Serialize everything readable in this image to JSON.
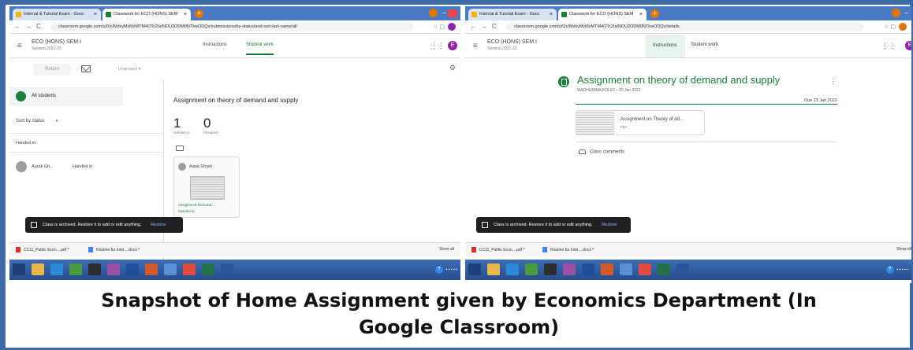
{
  "colors": {
    "frame": "#3f6aa8",
    "classroom_green": "#188038",
    "tabstrip": "#4b7bc4",
    "snackbar": "#202124",
    "restore_link": "#8ab4f8"
  },
  "left_screenshot": {
    "browser": {
      "tabs": [
        {
          "label": "Internal & Tutorial Exam - Gooc",
          "icon": "drive-icon"
        },
        {
          "label": "Classwork for ECO (HONS) SEM",
          "icon": "classroom-icon"
        }
      ],
      "new_tab": "+",
      "url": "classroom.google.com/u/0/c/MzkyMzMzMTM4OTc2/a/NDU2ODM0NTkwODQx/submissions/by-status/and-sort-last-name/all"
    },
    "header": {
      "class_name": "ECO (HONS) SEM I",
      "session": "Session 2021-22",
      "tab_instructions": "Instructions",
      "tab_student_work": "Student work"
    },
    "toolbar": {
      "return_label": "Return",
      "grade_filter": "Ungraded"
    },
    "sidebar": {
      "all_students": "All students",
      "sort_label": "Sort by status",
      "handed_in_heading": "Handed in",
      "student_name": "Aurak Gh...",
      "student_status": "Handed in"
    },
    "main": {
      "assignment_title": "Assignment on theory of demand and supply",
      "handed_in_count": "1",
      "handed_in_label": "Handed in",
      "assigned_count": "0",
      "assigned_label": "Assigned",
      "card_student": "Aurak Ghosh",
      "card_file": "Assignment-Demand ...",
      "card_status": "Handed in"
    },
    "snackbar": {
      "message": "Class is archived. Restore it to add or edit anything.",
      "action": "Restore"
    },
    "downloads": {
      "file1": "CC11_Public Econ....pdf",
      "file2": "Routine for Inter....docx",
      "show_all": "Show all"
    }
  },
  "right_screenshot": {
    "browser": {
      "tabs": [
        {
          "label": "Internal & Tutorial Exam - Gooc",
          "icon": "drive-icon"
        },
        {
          "label": "Classwork for ECO (HONS) SEM",
          "icon": "classroom-icon"
        }
      ],
      "new_tab": "+",
      "url": "classroom.google.com/u/0/c/MzkyMzMzMTM4OTc2/a/NDU2ODM0NTkwODQx/details"
    },
    "header": {
      "class_name": "ECO (HONS) SEM I",
      "session": "Session 2021-22",
      "tab_instructions": "Instructions",
      "tab_student_work": "Student work"
    },
    "assignment": {
      "title": "Assignment on theory of demand and supply",
      "byline": "MADHURIMA KOLEY • 20 Jan 2022",
      "due": "Due 23 Jan 2022",
      "attachment_name": "Assignment on Theory of dd...",
      "attachment_type": "PDF",
      "class_comments": "Class comments"
    },
    "snackbar": {
      "message": "Class is archived. Restore it to add or edit anything.",
      "action": "Restore"
    },
    "downloads": {
      "file1": "CC11_Public Econ....pdf",
      "file2": "Routine for Inter....docx",
      "show_all": "Show all"
    }
  },
  "caption": {
    "line1": "Snapshot of Home Assignment given by Economics Department (In",
    "line2": "Google Classroom)"
  }
}
